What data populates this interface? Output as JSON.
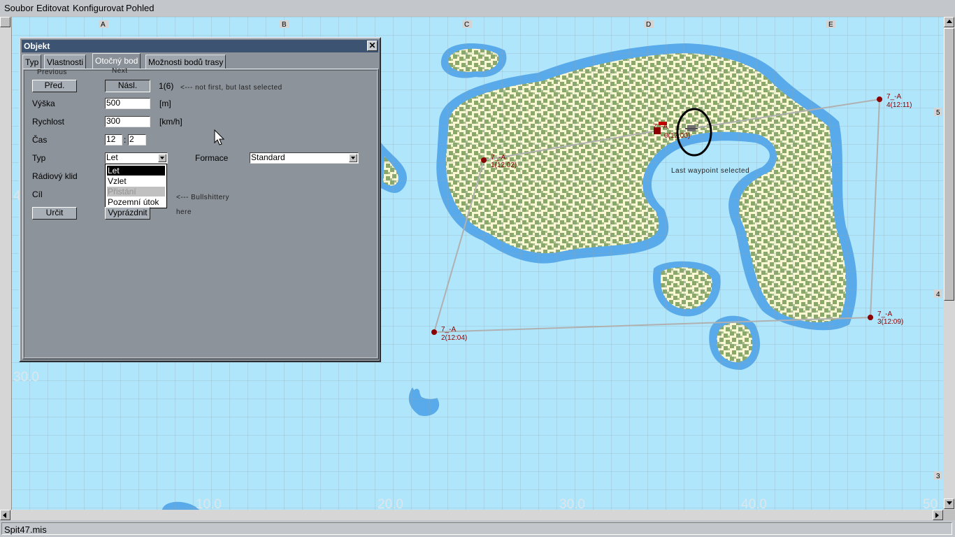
{
  "menu": [
    "Soubor",
    "Editovat",
    "Konfigurovat",
    "Pohled"
  ],
  "statusbar": {
    "filename": "Spit47.mis"
  },
  "map": {
    "grid_column_labels": [
      "A",
      "B",
      "C",
      "D",
      "E"
    ],
    "grid_row_labels": [
      "5",
      "4",
      "3"
    ],
    "edge_coordinate_labels_bottom": [
      "10.0",
      "20.0",
      "30.0",
      "40.0",
      "50"
    ],
    "edge_coordinate_label_left": "30.0",
    "edge_coordinate_label_left_cut": "4",
    "colors": {
      "sea": "#b0e6fb",
      "shallow": "#58aaea",
      "sand": "#fbf7d3",
      "forest": "#8aa86a",
      "route": "#b0b0b0",
      "waypoint": "#800000",
      "grid": "#8a9aa0"
    },
    "waypoints": [
      {
        "label": "7_-A",
        "sub": "0(12:00)"
      },
      {
        "label": "7_-A",
        "sub": "1(12:02)"
      },
      {
        "label": "7_-A",
        "sub": "2(12:04)"
      },
      {
        "label": "7_-A",
        "sub": "3(12:09)"
      },
      {
        "label": "7_-A",
        "sub": "4(12:11)"
      }
    ],
    "aircraft_label": "7",
    "annotation_last_waypoint": "Last waypoint selected"
  },
  "dialog": {
    "title": "Objekt",
    "close": "✕",
    "tabs": [
      "Typ",
      "Vlastnosti",
      "Otočný bod",
      "Možnosti bodů trasy"
    ],
    "active_tab": "Otočný bod",
    "hint_previous": "Previous",
    "hint_next": "Next",
    "btn_prev": "Před.",
    "btn_next": "Násl.",
    "counter": "1(6)",
    "hint_counter": "<--- not first, but last selected",
    "altitude_label": "Výška",
    "altitude_value": "500",
    "altitude_unit": "[m]",
    "speed_label": "Rychlost",
    "speed_value": "300",
    "speed_unit": "[km/h]",
    "time_label": "Čas",
    "time_hours": "12",
    "time_sep": ":",
    "time_minutes": "2",
    "type_label": "Typ",
    "type_value": "Let",
    "type_options": [
      "Let",
      "Vzlet",
      "Přistání",
      "Pozemní útok"
    ],
    "formation_label": "Formace",
    "formation_value": "Standard",
    "radio_label": "Rádiový klid",
    "target_label": "Cíl",
    "hint_bull_1": "<--- Bullshittery",
    "hint_bull_2": "here",
    "btn_set": "Určit",
    "btn_clear": "Vyprázdnit"
  }
}
